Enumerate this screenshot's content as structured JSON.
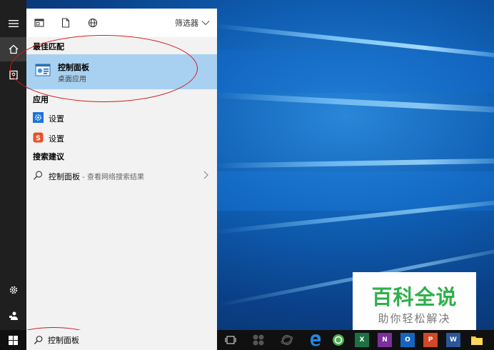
{
  "panel": {
    "filter_label": "筛选器",
    "best_match_heading": "最佳匹配",
    "best_match": {
      "title": "控制面板",
      "subtitle": "桌面应用"
    },
    "apps_heading": "应用",
    "apps": [
      {
        "label": "设置",
        "icon": "gear-settings-icon",
        "color": "#1e73d8"
      },
      {
        "label": "设置",
        "icon": "s-app-icon",
        "color": "#e8502a"
      }
    ],
    "suggestions_heading": "搜索建议",
    "suggestion": {
      "query": "控制面板",
      "hint": " - 查看网络搜索结果"
    }
  },
  "search": {
    "value": "控制面板"
  },
  "taskbar": {
    "apps": [
      {
        "name": "task-view",
        "label": ""
      },
      {
        "name": "app-1",
        "label": ""
      },
      {
        "name": "internet-explorer",
        "label": ""
      },
      {
        "name": "edge",
        "label": ""
      },
      {
        "name": "green-app",
        "label": ""
      },
      {
        "name": "excel",
        "label": "X"
      },
      {
        "name": "onenote",
        "label": "N"
      },
      {
        "name": "outlook",
        "label": "O"
      },
      {
        "name": "powerpoint",
        "label": "P"
      },
      {
        "name": "word",
        "label": "W"
      },
      {
        "name": "file-explorer",
        "label": ""
      }
    ]
  },
  "watermark": {
    "title": "百科全说",
    "subtitle": "助你轻松解决"
  },
  "colors": {
    "accent": "#0078d7",
    "highlight": "#a8d1f1",
    "annotation": "#d01a1a",
    "watermark_green": "#2fb04b"
  }
}
